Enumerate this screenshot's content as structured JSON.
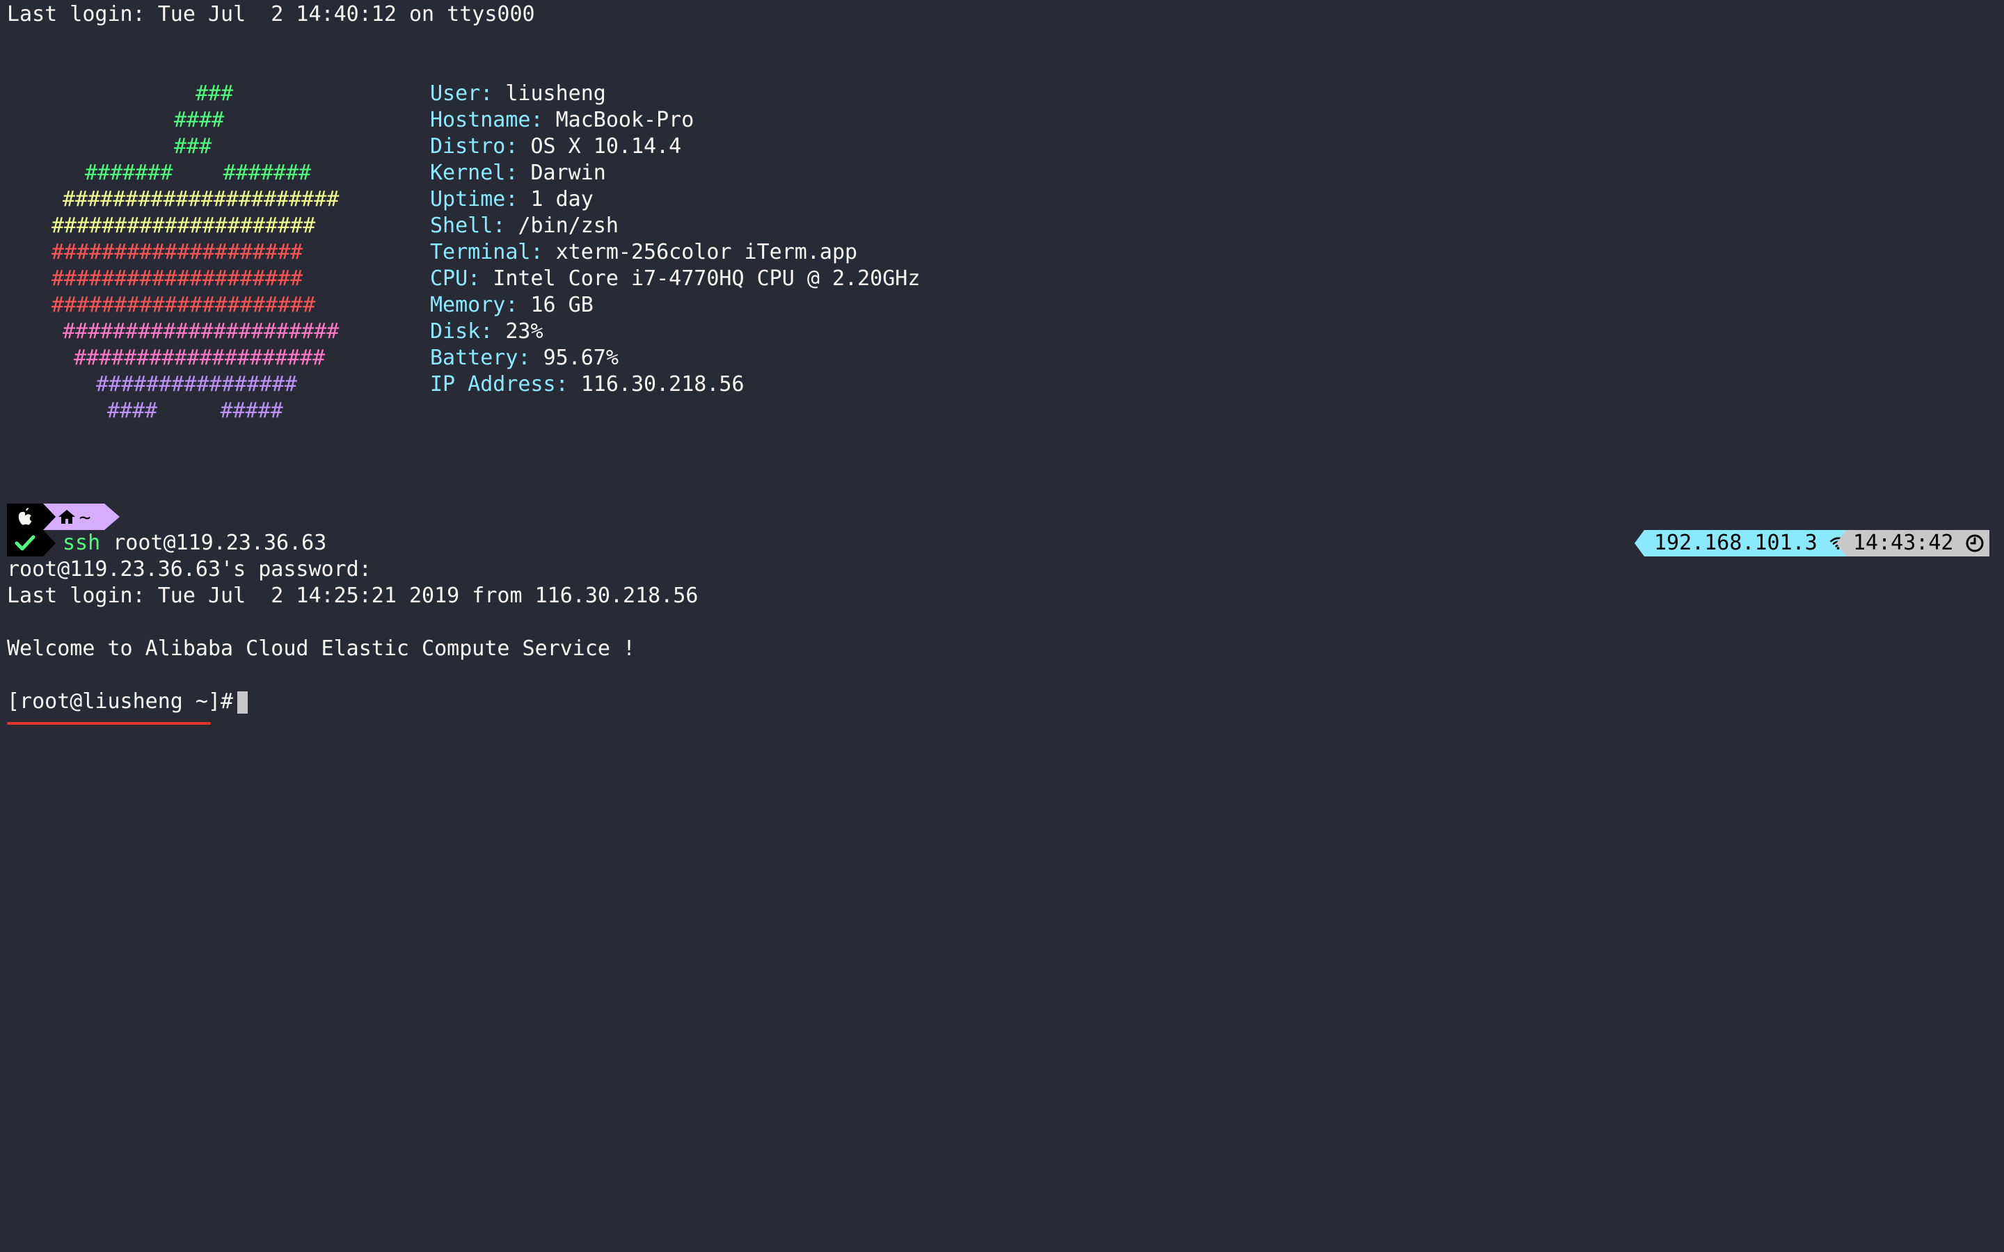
{
  "login_line": "Last login: Tue Jul  2 14:40:12 on ttys000",
  "ascii_logo": [
    {
      "text": "###",
      "color": "green"
    },
    {
      "text": "####",
      "color": "green"
    },
    {
      "text": "###",
      "color": "green"
    },
    {
      "text": "#######    #######",
      "color": "green"
    },
    {
      "text": "######################",
      "color": "yellow"
    },
    {
      "text": "#####################",
      "color": "yellow"
    },
    {
      "text": "####################",
      "color": "red"
    },
    {
      "text": "####################",
      "color": "red"
    },
    {
      "text": "#####################",
      "color": "red"
    },
    {
      "text": "######################",
      "color": "pink"
    },
    {
      "text": "####################",
      "color": "pink"
    },
    {
      "text": "################",
      "color": "violet"
    },
    {
      "text": "####     #####",
      "color": "violet"
    }
  ],
  "system_info": [
    {
      "key": "User:",
      "value": "liusheng"
    },
    {
      "key": "Hostname:",
      "value": "MacBook-Pro"
    },
    {
      "key": "Distro:",
      "value": "OS X 10.14.4"
    },
    {
      "key": "Kernel:",
      "value": "Darwin"
    },
    {
      "key": "Uptime:",
      "value": "1 day"
    },
    {
      "key": "Shell:",
      "value": "/bin/zsh"
    },
    {
      "key": "Terminal:",
      "value": "xterm-256color iTerm.app"
    },
    {
      "key": "CPU:",
      "value": "Intel Core i7-4770HQ CPU @ 2.20GHz"
    },
    {
      "key": "Memory:",
      "value": "16 GB"
    },
    {
      "key": "Disk:",
      "value": "23%"
    },
    {
      "key": "Battery:",
      "value": "95.67%"
    },
    {
      "key": "IP Address:",
      "value": "116.30.218.56"
    }
  ],
  "prompt": {
    "dir": "~",
    "command_name": "ssh",
    "command_args": "root@119.23.36.63"
  },
  "status_right": {
    "ip": "192.168.101.3",
    "time": "14:43:42"
  },
  "output": {
    "password_prompt": "root@119.23.36.63's password:",
    "last_login": "Last login: Tue Jul  2 14:25:21 2019 from 116.30.218.56",
    "welcome": "Welcome to Alibaba Cloud Elastic Compute Service !",
    "remote_prompt": "[root@liusheng ~]#"
  },
  "colors": {
    "background": "#282a36",
    "green": "#50fa7b",
    "yellow": "#f1fa8c",
    "red": "#ff5555",
    "pink": "#ff79c6",
    "violet": "#bd93f9",
    "info_key": "#8be9fd",
    "underline": "#e0362c"
  }
}
